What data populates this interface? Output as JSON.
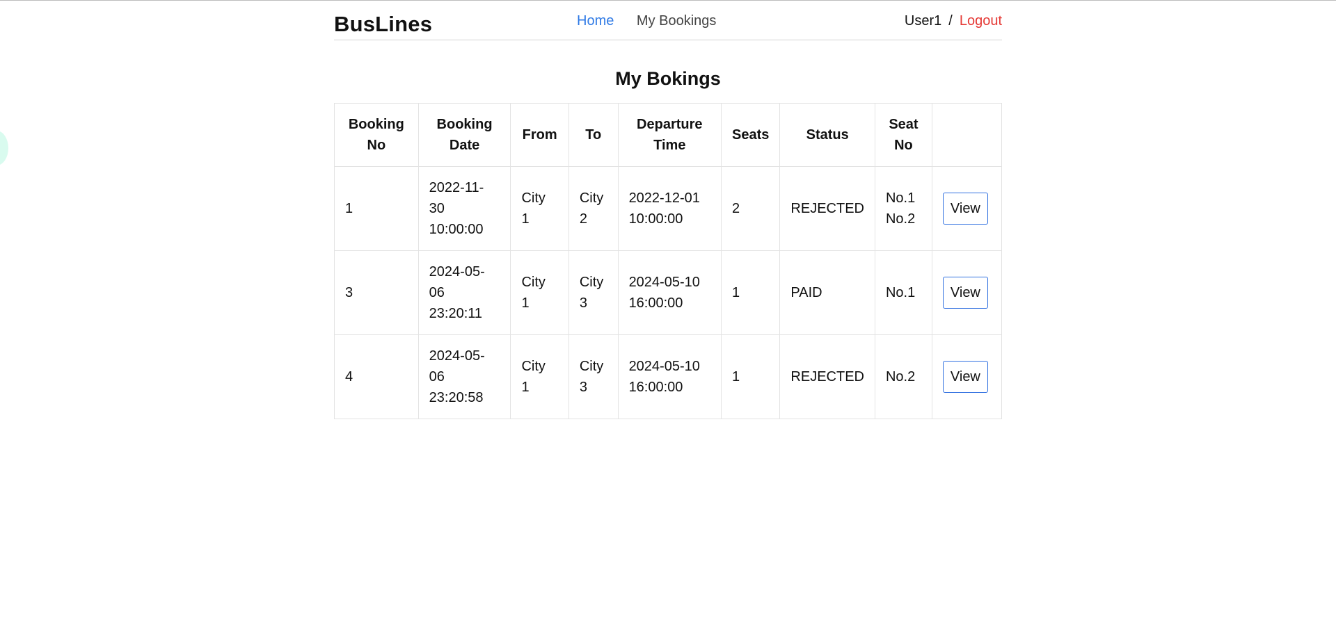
{
  "navbar": {
    "brand": "BusLines",
    "links": [
      {
        "label": "Home",
        "active": true
      },
      {
        "label": "My Bookings",
        "active": false
      }
    ],
    "user": "User1",
    "separator": "/",
    "logout": "Logout"
  },
  "page": {
    "title": "My Bokings"
  },
  "table": {
    "headers": [
      [
        "Booking",
        "No"
      ],
      [
        "Booking",
        "Date"
      ],
      [
        "From"
      ],
      [
        "To"
      ],
      [
        "Departure",
        "Time"
      ],
      [
        "Seats"
      ],
      [
        "Status"
      ],
      [
        "Seat",
        "No"
      ],
      []
    ],
    "rows": [
      {
        "booking_no": "1",
        "booking_date": [
          "2022-11-",
          "30",
          "10:00:00"
        ],
        "from": [
          "City",
          "1"
        ],
        "to": [
          "City",
          "2"
        ],
        "departure": [
          "2022-12-01",
          "10:00:00"
        ],
        "seats": "2",
        "status": "REJECTED",
        "seat_no": [
          "No.1",
          "No.2"
        ],
        "action": "View"
      },
      {
        "booking_no": "3",
        "booking_date": [
          "2024-05-",
          "06",
          "23:20:11"
        ],
        "from": [
          "City",
          "1"
        ],
        "to": [
          "City",
          "3"
        ],
        "departure": [
          "2024-05-10",
          "16:00:00"
        ],
        "seats": "1",
        "status": "PAID",
        "seat_no": [
          "No.1"
        ],
        "action": "View"
      },
      {
        "booking_no": "4",
        "booking_date": [
          "2024-05-",
          "06",
          "23:20:58"
        ],
        "from": [
          "City",
          "1"
        ],
        "to": [
          "City",
          "3"
        ],
        "departure": [
          "2024-05-10",
          "16:00:00"
        ],
        "seats": "1",
        "status": "REJECTED",
        "seat_no": [
          "No.2"
        ],
        "action": "View"
      }
    ]
  },
  "colors": {
    "active_link": "#2f7ae5",
    "logout": "#e53935",
    "button_border": "#2f6fe0"
  }
}
